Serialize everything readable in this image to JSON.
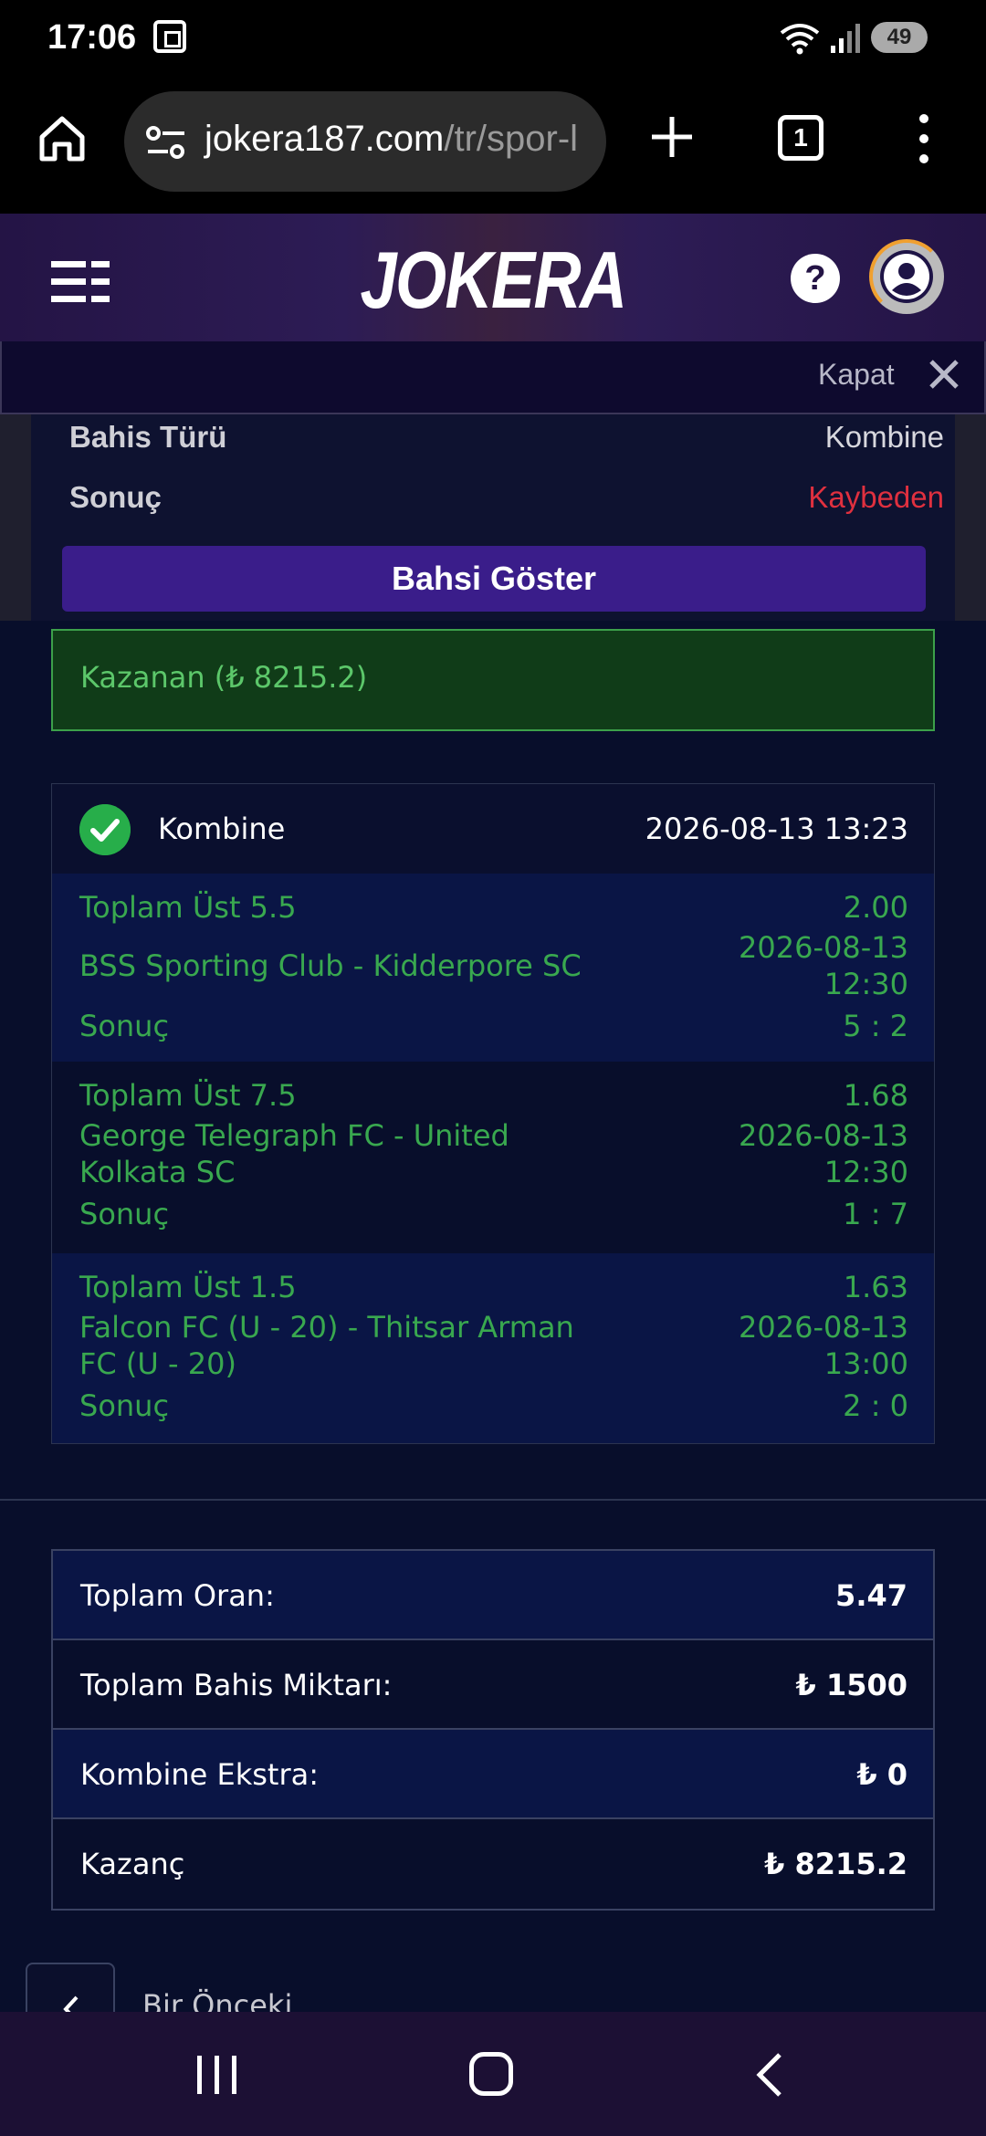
{
  "status_bar": {
    "time": "17:06",
    "battery": "49"
  },
  "browser": {
    "url_domain": "jokera187.com",
    "url_path": "/tr/spor-l",
    "tab_count": "1"
  },
  "site": {
    "logo": "JOKERA",
    "help_label": "?"
  },
  "close_bar": {
    "label": "Kapat"
  },
  "bet_summary": {
    "bet_type_label": "Bahis Türü",
    "bet_type_value": "Kombine",
    "result_label": "Sonuç",
    "result_value": "Kaybeden",
    "show_button": "Bahsi Göster"
  },
  "winner_banner": "Kazanan (₺ 8215.2)",
  "coupon": {
    "type": "Kombine",
    "datetime": "2026-08-13 13:23",
    "selections": [
      {
        "market": "Toplam Üst 5.5",
        "odds": "2.00",
        "match_line1": "BSS Sporting Club - Kidderpore SC",
        "match_line2": "",
        "date": "2026-08-13",
        "time": "12:30",
        "result_label": "Sonuç",
        "score": "5 : 2"
      },
      {
        "market": "Toplam Üst 7.5",
        "odds": "1.68",
        "match_line1": "George Telegraph FC - United",
        "match_line2": "Kolkata SC",
        "date": "2026-08-13",
        "time": "12:30",
        "result_label": "Sonuç",
        "score": "1 : 7"
      },
      {
        "market": "Toplam Üst 1.5",
        "odds": "1.63",
        "match_line1": "Falcon FC (U - 20) - Thitsar Arman",
        "match_line2": "FC (U - 20)",
        "date": "2026-08-13",
        "time": "13:00",
        "result_label": "Sonuç",
        "score": "2 : 0"
      }
    ]
  },
  "totals": [
    {
      "label": "Toplam Oran:",
      "value": "5.47"
    },
    {
      "label": "Toplam Bahis Miktarı:",
      "value": "₺ 1500"
    },
    {
      "label": "Kombine Ekstra:",
      "value": "₺ 0"
    },
    {
      "label": "Kazanç",
      "value": "₺ 8215.2"
    }
  ],
  "prev_label": "Bir Önceki",
  "colors": {
    "accent": "#3a1d8a",
    "win_green": "#39a84f",
    "lose_red": "#e0303f",
    "header": "#241445"
  }
}
